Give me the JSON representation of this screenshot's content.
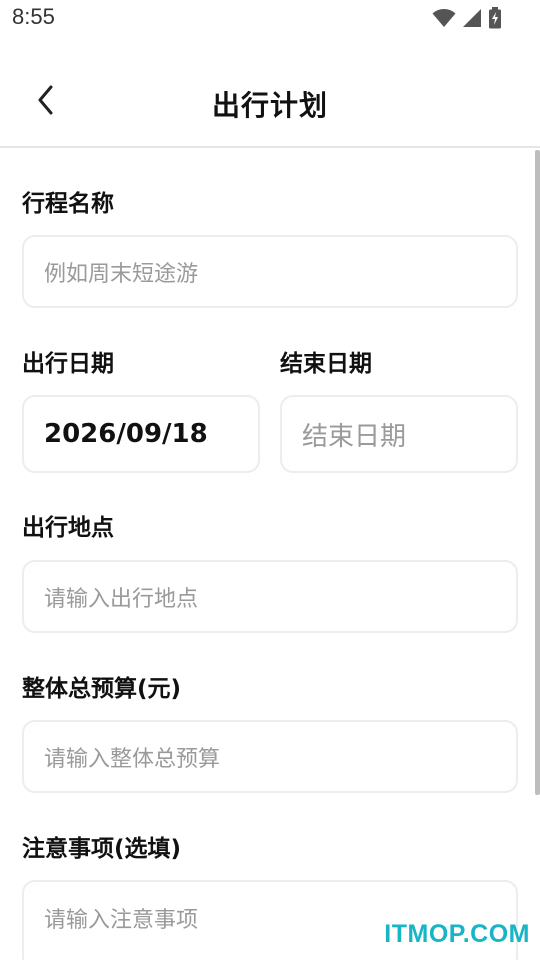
{
  "status_bar": {
    "time": "8:55",
    "icons": [
      "wifi-icon",
      "cellular-signal-icon",
      "battery-charging-icon"
    ]
  },
  "header": {
    "title": "出行计划",
    "back_icon": "chevron-left-icon"
  },
  "form": {
    "trip_name": {
      "label": "行程名称",
      "placeholder": "例如周末短途游"
    },
    "start_date": {
      "label": "出行日期",
      "value": "2026/09/18"
    },
    "end_date": {
      "label": "结束日期",
      "placeholder": "结束日期"
    },
    "location": {
      "label": "出行地点",
      "placeholder": "请输入出行地点"
    },
    "budget": {
      "label": "整体总预算(元)",
      "placeholder": "请输入整体总预算"
    },
    "notes": {
      "label": "注意事项(选填)",
      "placeholder": "请输入注意事项"
    }
  },
  "watermark": "ITMOP.COM",
  "colors": {
    "watermark": "#17b5c5",
    "border": "#ededed",
    "placeholder": "#9a9a9a"
  }
}
